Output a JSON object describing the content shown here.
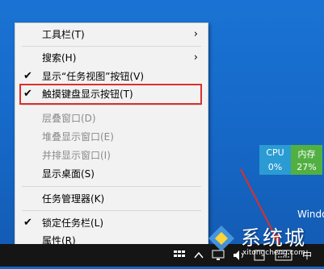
{
  "context_menu": {
    "items": [
      {
        "label": "工具栏(T)",
        "arrow": "›"
      },
      {
        "label": "搜索(H)",
        "arrow": "›"
      },
      {
        "label": "显示“任务视图”按钮(V)",
        "check": "✔"
      },
      {
        "label": "触摸键盘显示按钮(T)",
        "check": "✔"
      },
      {
        "label": "层叠窗口(D)"
      },
      {
        "label": "堆叠显示窗口(E)"
      },
      {
        "label": "并排显示窗口(I)"
      },
      {
        "label": "显示桌面(S)"
      },
      {
        "label": "任务管理器(K)"
      },
      {
        "label": "锁定任务栏(L)",
        "check": "✔"
      },
      {
        "label": "属性(R)"
      }
    ]
  },
  "performance": {
    "cpu": {
      "label": "CPU",
      "value": "0%"
    },
    "memory": {
      "label": "内存",
      "value": "27%"
    }
  },
  "desktop_text": "Windo",
  "tray": {
    "ime": "中"
  },
  "watermark": {
    "text": "系统城",
    "url": "xitongcheng.com"
  },
  "colors": {
    "desktop": "#1566c4",
    "menu_bg": "#f2f2f2",
    "highlight": "#d9302b",
    "cpu": "#2b9bd3",
    "memory": "#52b043",
    "taskbar": "#151515"
  }
}
